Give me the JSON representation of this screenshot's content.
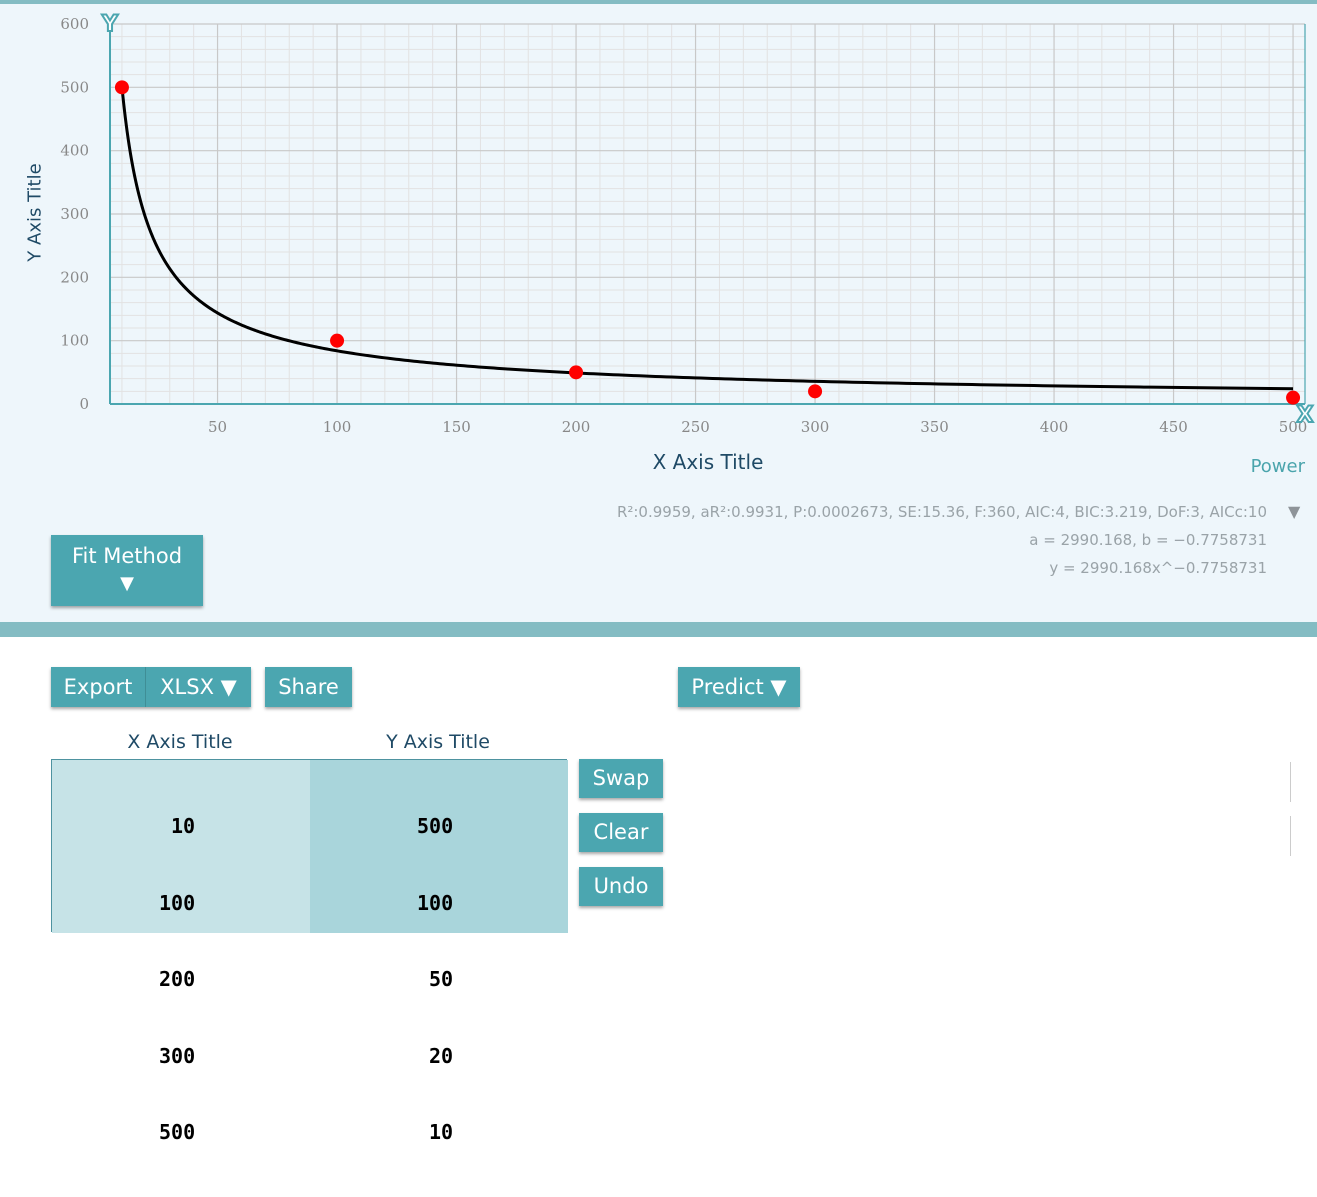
{
  "fit": {
    "name": "Power",
    "stats_line1": "R²:0.9959, aR²:0.9931, P:0.0002673, SE:15.36, F:360, AIC:4, BIC:3.219, DoF:3, AICc:10",
    "stats_line2": "a = 2990.168, b = −0.7758731",
    "stats_line3": "y = 2990.168x^−0.7758731",
    "a": 2990.168,
    "b": -0.7758731
  },
  "buttons": {
    "fit_method": "Fit Method",
    "fit_method_caret": "▼",
    "export": "Export",
    "format": "XLSX ▼",
    "share": "Share",
    "predict": "Predict ▼",
    "swap": "Swap",
    "clear": "Clear",
    "undo": "Undo"
  },
  "stats_caret": "▼",
  "table": {
    "x_header": "X Axis Title",
    "y_header": "Y Axis Title",
    "rows": [
      {
        "x": "10",
        "y": "500"
      },
      {
        "x": "100",
        "y": "100"
      },
      {
        "x": "200",
        "y": "50"
      },
      {
        "x": "300",
        "y": "20"
      },
      {
        "x": "500",
        "y": "10"
      }
    ]
  },
  "chart_data": {
    "type": "scatter",
    "xlabel": "X Axis Title",
    "ylabel": "Y Axis Title",
    "xlim": [
      5,
      505
    ],
    "ylim": [
      0,
      600
    ],
    "x_ticks": [
      "50",
      "100",
      "150",
      "200",
      "250",
      "300",
      "350",
      "400",
      "450",
      "500"
    ],
    "y_ticks": [
      "0",
      "100",
      "200",
      "300",
      "400",
      "500",
      "600"
    ],
    "x_handle_label": "X",
    "y_handle_label": "Y",
    "grid": true,
    "points": [
      {
        "x": 10,
        "y": 500
      },
      {
        "x": 100,
        "y": 100
      },
      {
        "x": 200,
        "y": 50
      },
      {
        "x": 300,
        "y": 20
      },
      {
        "x": 500,
        "y": 10
      }
    ],
    "fit_curve": {
      "model": "power",
      "a": 2990.168,
      "b": -0.7758731,
      "x_range": [
        10,
        500
      ]
    },
    "colors": {
      "point": "#ff0000",
      "curve": "#000000",
      "axis": "#4ba6b0",
      "grid_major": "#c8c8c8",
      "grid_minor": "#e2e2e2",
      "tick_label": "#888888"
    }
  }
}
